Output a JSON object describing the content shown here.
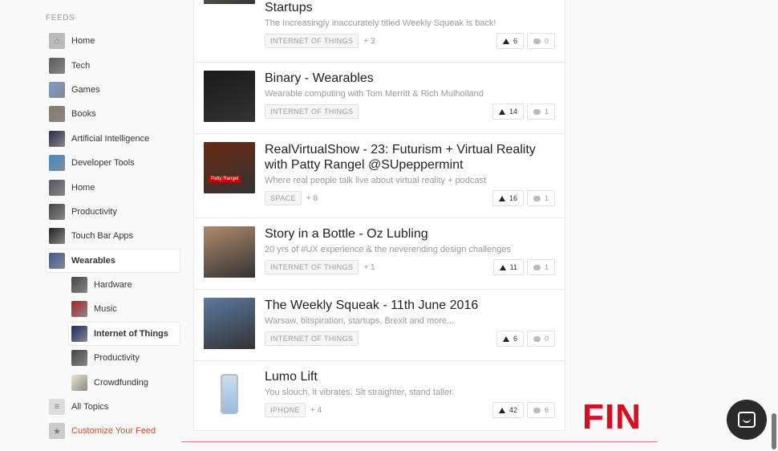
{
  "sidebar": {
    "section_label": "FEEDS",
    "items": [
      {
        "label": "Home",
        "icon": "home-icon",
        "color": "#bbbbbb",
        "glyph": "⌂"
      },
      {
        "label": "Tech",
        "icon": "tech-icon",
        "color": "#5a5a5a",
        "glyph": ""
      },
      {
        "label": "Games",
        "icon": "games-icon",
        "color": "#7a9bd6",
        "glyph": ""
      },
      {
        "label": "Books",
        "icon": "books-icon",
        "color": "#8a7a66",
        "glyph": ""
      },
      {
        "label": "Artificial Intelligence",
        "icon": "ai-icon",
        "color": "#2a2a4a",
        "glyph": ""
      },
      {
        "label": "Developer Tools",
        "icon": "developer-tools-icon",
        "color": "#3b8fd6",
        "glyph": ""
      },
      {
        "label": "Home",
        "icon": "home-alt-icon",
        "color": "#555566",
        "glyph": ""
      },
      {
        "label": "Productivity",
        "icon": "productivity-icon",
        "color": "#444444",
        "glyph": ""
      },
      {
        "label": "Touch Bar Apps",
        "icon": "touch-bar-icon",
        "color": "#222222",
        "glyph": ""
      },
      {
        "label": "Wearables",
        "icon": "wearables-icon",
        "color": "#3a5a9a",
        "glyph": ""
      },
      {
        "label": "Hardware",
        "icon": "hardware-icon",
        "color": "#444444",
        "glyph": ""
      },
      {
        "label": "Music",
        "icon": "music-icon",
        "color": "#b02020",
        "glyph": ""
      },
      {
        "label": "Internet of Things",
        "icon": "iot-icon",
        "color": "#1a2a6a",
        "glyph": ""
      },
      {
        "label": "Productivity",
        "icon": "productivity-alt-icon",
        "color": "#444444",
        "glyph": ""
      },
      {
        "label": "Crowdfunding",
        "icon": "crowdfunding-icon",
        "color": "#f2e6c8",
        "glyph": ""
      },
      {
        "label": "All Topics",
        "icon": "all-topics-icon",
        "color": "#dddddd",
        "glyph": "≡"
      },
      {
        "label": "Customize Your Feed",
        "icon": "star-icon",
        "color": "#cccccc",
        "glyph": "★"
      }
    ]
  },
  "posts": [
    {
      "title": "The Weekly Squeak - IFA and the Long Night of Startups",
      "tagline": "The Increasingly inaccurately titled Weekly Squeak is back!",
      "tag": "INTERNET OF THINGS",
      "more": "+ 3",
      "votes": "6",
      "comments": "0",
      "thumb_color": "#9a8a6a"
    },
    {
      "title": "Binary - Wearables",
      "tagline": "Wearable computing with Tom Merritt & Rich Mulholland",
      "tag": "INTERNET OF THINGS",
      "more": "",
      "votes": "14",
      "comments": "1",
      "thumb_color": "#1a1a1a"
    },
    {
      "title": "RealVirtualShow - 23: Futurism + Virtual Reality with Patty Rangel @SUpeppermint",
      "tagline": "Where real people talk live about virtual reality + podcast",
      "tag": "SPACE",
      "more": "+ 8",
      "votes": "16",
      "comments": "1",
      "thumb_color": "#6a2a10",
      "thumb_caption": "Patty Rangel"
    },
    {
      "title": "Story in a Bottle - Oz Lubling",
      "tagline": "20 yrs of #UX experience & the neverending design challenges",
      "tag": "INTERNET OF THINGS",
      "more": "+ 1",
      "votes": "11",
      "comments": "1",
      "thumb_color": "#b08a6a"
    },
    {
      "title": "The Weekly Squeak - 11th June 2016",
      "tagline": "Warsaw, bitspiration, startups, Brexit and more...",
      "tag": "INTERNET OF THINGS",
      "more": "",
      "votes": "6",
      "comments": "0",
      "thumb_color": "#5a7aa0"
    },
    {
      "title": "Lumo Lift",
      "tagline": "You slouch, it vibrates. Sit straighter, stand taller.",
      "tag": "IPHONE",
      "more": "+ 4",
      "votes": "42",
      "comments": "6",
      "thumb_color": "#ffffff"
    }
  ],
  "overlay": {
    "fin_text": "FIN"
  }
}
